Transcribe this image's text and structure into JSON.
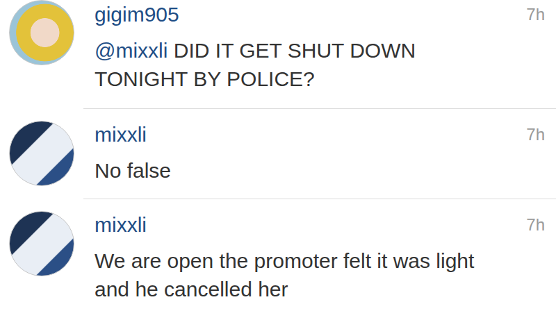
{
  "comments": [
    {
      "username": "gigim905",
      "time": "7h",
      "mention": "@mixxli",
      "text": "DID IT GET SHUT DOWN TONIGHT BY POLICE?",
      "avatar": {
        "kind": "photo"
      }
    },
    {
      "username": "mixxli",
      "time": "7h",
      "text": "No false",
      "avatar": {
        "kind": "flyer"
      }
    },
    {
      "username": "mixxli",
      "time": "7h",
      "text": "We are open the promoter felt it was light and he cancelled her",
      "avatar": {
        "kind": "flyer"
      }
    }
  ]
}
